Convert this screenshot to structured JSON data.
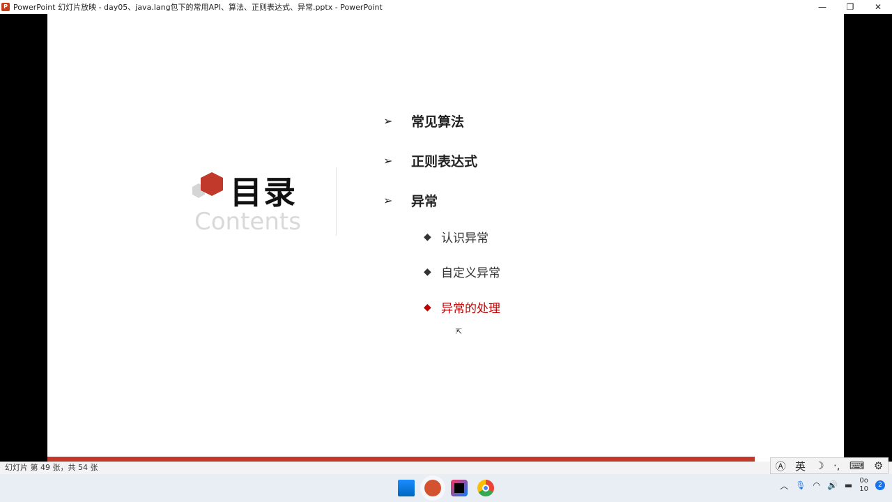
{
  "window": {
    "title": "PowerPoint 幻灯片放映  -  day05、java.lang包下的常用API、算法、正则表达式、异常.pptx - PowerPoint",
    "minimize": "—",
    "restore": "❐",
    "close": "✕"
  },
  "slide": {
    "title_cn": "目录",
    "title_en": "Contents",
    "items": [
      {
        "label": "常见算法"
      },
      {
        "label": "正则表达式"
      },
      {
        "label": "异常"
      }
    ],
    "subitems": [
      {
        "label": "认识异常",
        "color": "#333333"
      },
      {
        "label": "自定义异常",
        "color": "#333333"
      },
      {
        "label": "异常的处理",
        "color": "#c00000"
      }
    ],
    "accent": "#c0392b"
  },
  "status": {
    "slide_info": "幻灯片 第 49 张，共 54 张"
  },
  "ime": {
    "mode": "英"
  },
  "taskbar": {
    "apps": [
      "start-icon",
      "powerpoint-icon",
      "intellij-icon",
      "chrome-icon"
    ]
  },
  "tray": {
    "time": "0o",
    "date": "10",
    "notifications": "2"
  }
}
